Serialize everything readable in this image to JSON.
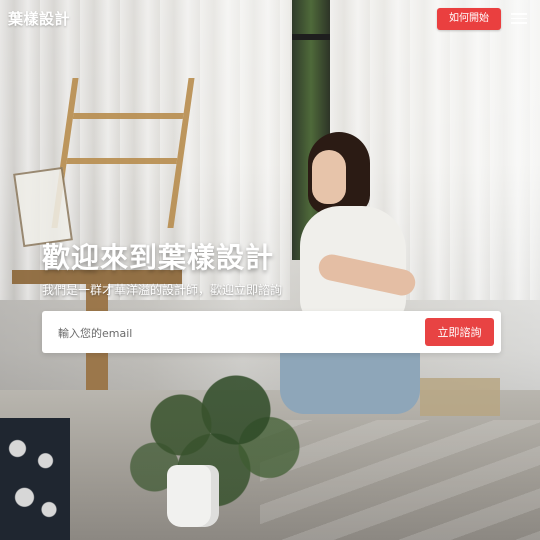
{
  "header": {
    "logo": "葉樣設計",
    "cta_label": "如何開始",
    "menu_icon": "hamburger-menu-icon"
  },
  "hero": {
    "title": "歡迎來到葉樣設計",
    "subtitle": "我們是一群才華洋溢的設計師，歡迎立即諮詢",
    "email_placeholder": "輸入您的email",
    "submit_label": "立即諮詢"
  },
  "colors": {
    "accent": "#E84343",
    "text_on_image": "#FFFFFF",
    "form_background": "#FFFFFF"
  }
}
